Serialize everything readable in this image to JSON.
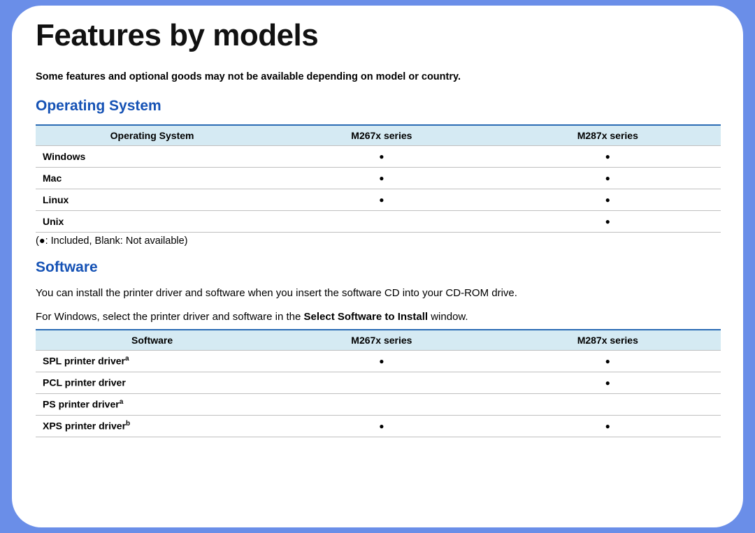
{
  "title": "Features by models",
  "intro": "Some features and optional goods may not be available depending on model or country.",
  "section_os": {
    "heading": "Operating System",
    "columns": [
      "Operating System",
      "M267x series",
      "M287x series"
    ],
    "rows": [
      {
        "label": "Windows",
        "m267": "●",
        "m287": "●"
      },
      {
        "label": "Mac",
        "m267": "●",
        "m287": "●"
      },
      {
        "label": "Linux",
        "m267": "●",
        "m287": "●"
      },
      {
        "label": "Unix",
        "m267": "",
        "m287": "●"
      }
    ],
    "legend": "(●: Included, Blank: Not available)"
  },
  "section_sw": {
    "heading": "Software",
    "para1_a": "You can install the printer driver and software when you insert the software CD into your CD-ROM drive.",
    "para2_pre": "For Windows, select the printer driver and software in the ",
    "para2_bold": "Select Software to Install",
    "para2_post": " window.",
    "columns": [
      "Software",
      "M267x series",
      "M287x series"
    ],
    "rows": [
      {
        "label": "SPL printer driver",
        "sup": "a",
        "m267": "●",
        "m287": "●"
      },
      {
        "label": "PCL printer driver",
        "sup": "",
        "m267": "",
        "m287": "●"
      },
      {
        "label": "PS printer driver",
        "sup": "a",
        "m267": "",
        "m287": ""
      },
      {
        "label": "XPS printer driver",
        "sup": "b",
        "m267": "●",
        "m287": "●"
      }
    ]
  }
}
